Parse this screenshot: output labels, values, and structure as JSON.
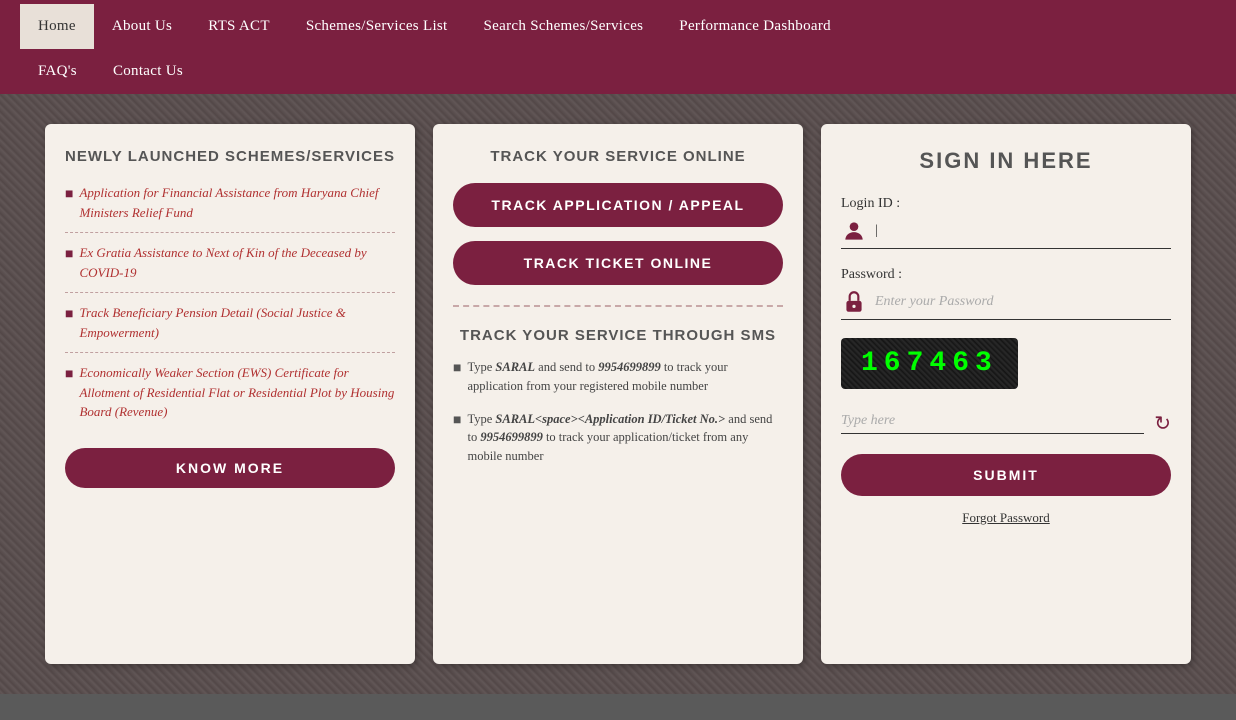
{
  "nav": {
    "items_row1": [
      {
        "label": "Home",
        "active": true
      },
      {
        "label": "About Us",
        "active": false
      },
      {
        "label": "RTS ACT",
        "active": false
      },
      {
        "label": "Schemes/Services List",
        "active": false
      },
      {
        "label": "Search Schemes/Services",
        "active": false
      },
      {
        "label": "Performance Dashboard",
        "active": false
      }
    ],
    "items_row2": [
      {
        "label": "FAQ's",
        "active": false
      },
      {
        "label": "Contact Us",
        "active": false
      }
    ]
  },
  "card1": {
    "title": "NEWLY LAUNCHED SCHEMES/SERVICES",
    "schemes": [
      "Application for Financial Assistance from Haryana Chief Ministers Relief Fund",
      "Ex Gratia Assistance to Next of Kin of the Deceased by COVID-19",
      "Track Beneficiary Pension Detail (Social Justice & Empowerment)",
      "Economically Weaker Section (EWS) Certificate for Allotment of Residential Flat or Residential Plot by Housing Board (Revenue)"
    ],
    "know_more_label": "KNOW MORE"
  },
  "card2": {
    "title": "TRACK YOUR SERVICE ONLINE",
    "track_app_btn": "TRACK APPLICATION / APPEAL",
    "track_ticket_btn": "TRACK TICKET ONLINE",
    "sms_title": "TRACK YOUR SERVICE THROUGH SMS",
    "sms_items": [
      "Type SARAL and send to 9954699899 to track your application from your registered mobile number",
      "Type SARAL<space><Application ID/Ticket No.> and send to 9954699899 to track your application/ticket from any mobile number"
    ]
  },
  "card3": {
    "title": "SIGN IN HERE",
    "login_id_label": "Login ID :",
    "password_label": "Password :",
    "password_placeholder": "Enter your Password",
    "captcha_value": "167463",
    "captcha_placeholder": "Type here",
    "submit_label": "SUBMIT",
    "forgot_password_label": "Forgot Password"
  }
}
